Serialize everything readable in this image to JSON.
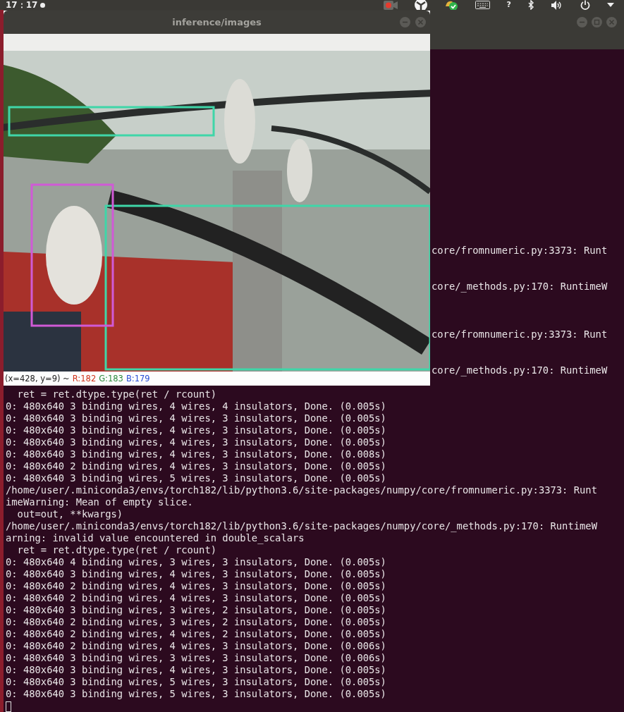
{
  "top_bar": {
    "clock": "17：17",
    "help": "?"
  },
  "viewer": {
    "title": "inference/images",
    "status": {
      "position": "(x=428, y=9) ~",
      "channels": [
        {
          "text": "R:182",
          "color": "#d0331b"
        },
        {
          "text": "G:183",
          "color": "#2e8b3e"
        },
        {
          "text": "B:179",
          "color": "#2a4fd6"
        }
      ]
    }
  },
  "terminal": {
    "lines": [
      {
        "kind": "fragment",
        "text": "core/fromnumeric.py:3373: Runt"
      },
      {
        "kind": "covered"
      },
      {
        "kind": "covered"
      },
      {
        "kind": "fragment",
        "text": "core/_methods.py:170: RuntimeW"
      },
      {
        "kind": "covered"
      },
      {
        "kind": "covered"
      },
      {
        "kind": "covered"
      },
      {
        "kind": "fragment",
        "text": "core/fromnumeric.py:3373: Runt"
      },
      {
        "kind": "covered"
      },
      {
        "kind": "covered"
      },
      {
        "kind": "fragment",
        "text": "core/_methods.py:170: RuntimeW"
      },
      {
        "kind": "covered"
      },
      {
        "kind": "line",
        "text": "  ret = ret.dtype.type(ret / rcount)"
      },
      {
        "kind": "line",
        "text": "0: 480x640 3 binding wires, 4 wires, 4 insulators, Done. (0.005s)"
      },
      {
        "kind": "line",
        "text": "0: 480x640 3 binding wires, 4 wires, 3 insulators, Done. (0.005s)"
      },
      {
        "kind": "line",
        "text": "0: 480x640 3 binding wires, 4 wires, 3 insulators, Done. (0.005s)"
      },
      {
        "kind": "line",
        "text": "0: 480x640 3 binding wires, 4 wires, 3 insulators, Done. (0.005s)"
      },
      {
        "kind": "line",
        "text": "0: 480x640 3 binding wires, 4 wires, 3 insulators, Done. (0.008s)"
      },
      {
        "kind": "line",
        "text": "0: 480x640 2 binding wires, 4 wires, 3 insulators, Done. (0.005s)"
      },
      {
        "kind": "line",
        "text": "0: 480x640 3 binding wires, 5 wires, 3 insulators, Done. (0.005s)"
      },
      {
        "kind": "line",
        "text": "/home/user/.miniconda3/envs/torch182/lib/python3.6/site-packages/numpy/core/fromnumeric.py:3373: Runt"
      },
      {
        "kind": "line",
        "text": "imeWarning: Mean of empty slice."
      },
      {
        "kind": "line",
        "text": "  out=out, **kwargs)"
      },
      {
        "kind": "line",
        "text": "/home/user/.miniconda3/envs/torch182/lib/python3.6/site-packages/numpy/core/_methods.py:170: RuntimeW"
      },
      {
        "kind": "line",
        "text": "arning: invalid value encountered in double_scalars"
      },
      {
        "kind": "line",
        "text": "  ret = ret.dtype.type(ret / rcount)"
      },
      {
        "kind": "line",
        "text": "0: 480x640 4 binding wires, 3 wires, 3 insulators, Done. (0.005s)"
      },
      {
        "kind": "line",
        "text": "0: 480x640 3 binding wires, 4 wires, 3 insulators, Done. (0.005s)"
      },
      {
        "kind": "line",
        "text": "0: 480x640 2 binding wires, 4 wires, 3 insulators, Done. (0.005s)"
      },
      {
        "kind": "line",
        "text": "0: 480x640 2 binding wires, 4 wires, 3 insulators, Done. (0.005s)"
      },
      {
        "kind": "line",
        "text": "0: 480x640 3 binding wires, 3 wires, 2 insulators, Done. (0.005s)"
      },
      {
        "kind": "line",
        "text": "0: 480x640 2 binding wires, 3 wires, 2 insulators, Done. (0.005s)"
      },
      {
        "kind": "line",
        "text": "0: 480x640 2 binding wires, 4 wires, 2 insulators, Done. (0.005s)"
      },
      {
        "kind": "line",
        "text": "0: 480x640 2 binding wires, 4 wires, 3 insulators, Done. (0.006s)"
      },
      {
        "kind": "line",
        "text": "0: 480x640 3 binding wires, 3 wires, 3 insulators, Done. (0.006s)"
      },
      {
        "kind": "line",
        "text": "0: 480x640 3 binding wires, 4 wires, 3 insulators, Done. (0.005s)"
      },
      {
        "kind": "line",
        "text": "0: 480x640 3 binding wires, 5 wires, 3 insulators, Done. (0.005s)"
      },
      {
        "kind": "line",
        "text": "0: 480x640 3 binding wires, 5 wires, 3 insulators, Done. (0.005s)"
      },
      {
        "kind": "cursor"
      }
    ]
  }
}
